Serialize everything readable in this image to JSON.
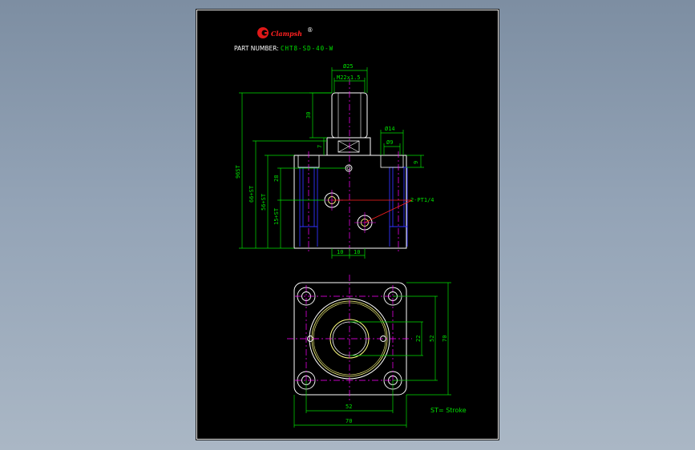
{
  "title_block": {
    "brand": "Clampsh",
    "brand_mark": "®",
    "part_number_label": "PART NUMBER:",
    "part_number_value": "CHT8-SD-40-W"
  },
  "front_view_dims": {
    "d25": "Ø25",
    "thread": "M22x1.5",
    "h30": "30",
    "h7": "7",
    "d14": "Ø14",
    "d9": "Ø9",
    "h9": "9",
    "h28": "28",
    "st96": "96ST",
    "st66": "66+ST",
    "st56": "56+ST",
    "st15": "15+ST",
    "port": "2-PT1/4",
    "w10a": "10",
    "w10b": "10"
  },
  "top_view_dims": {
    "d22": "22",
    "d52v": "52",
    "d70v": "70",
    "d52h": "52",
    "d70h": "70"
  },
  "note": "ST= Stroke",
  "colors": {
    "outline": "#ffffff",
    "dimension": "#00e000",
    "hidden": "#3030ff",
    "centerline": "#ff00ff",
    "leader": "#ff2020",
    "ring": "#ffff80"
  }
}
